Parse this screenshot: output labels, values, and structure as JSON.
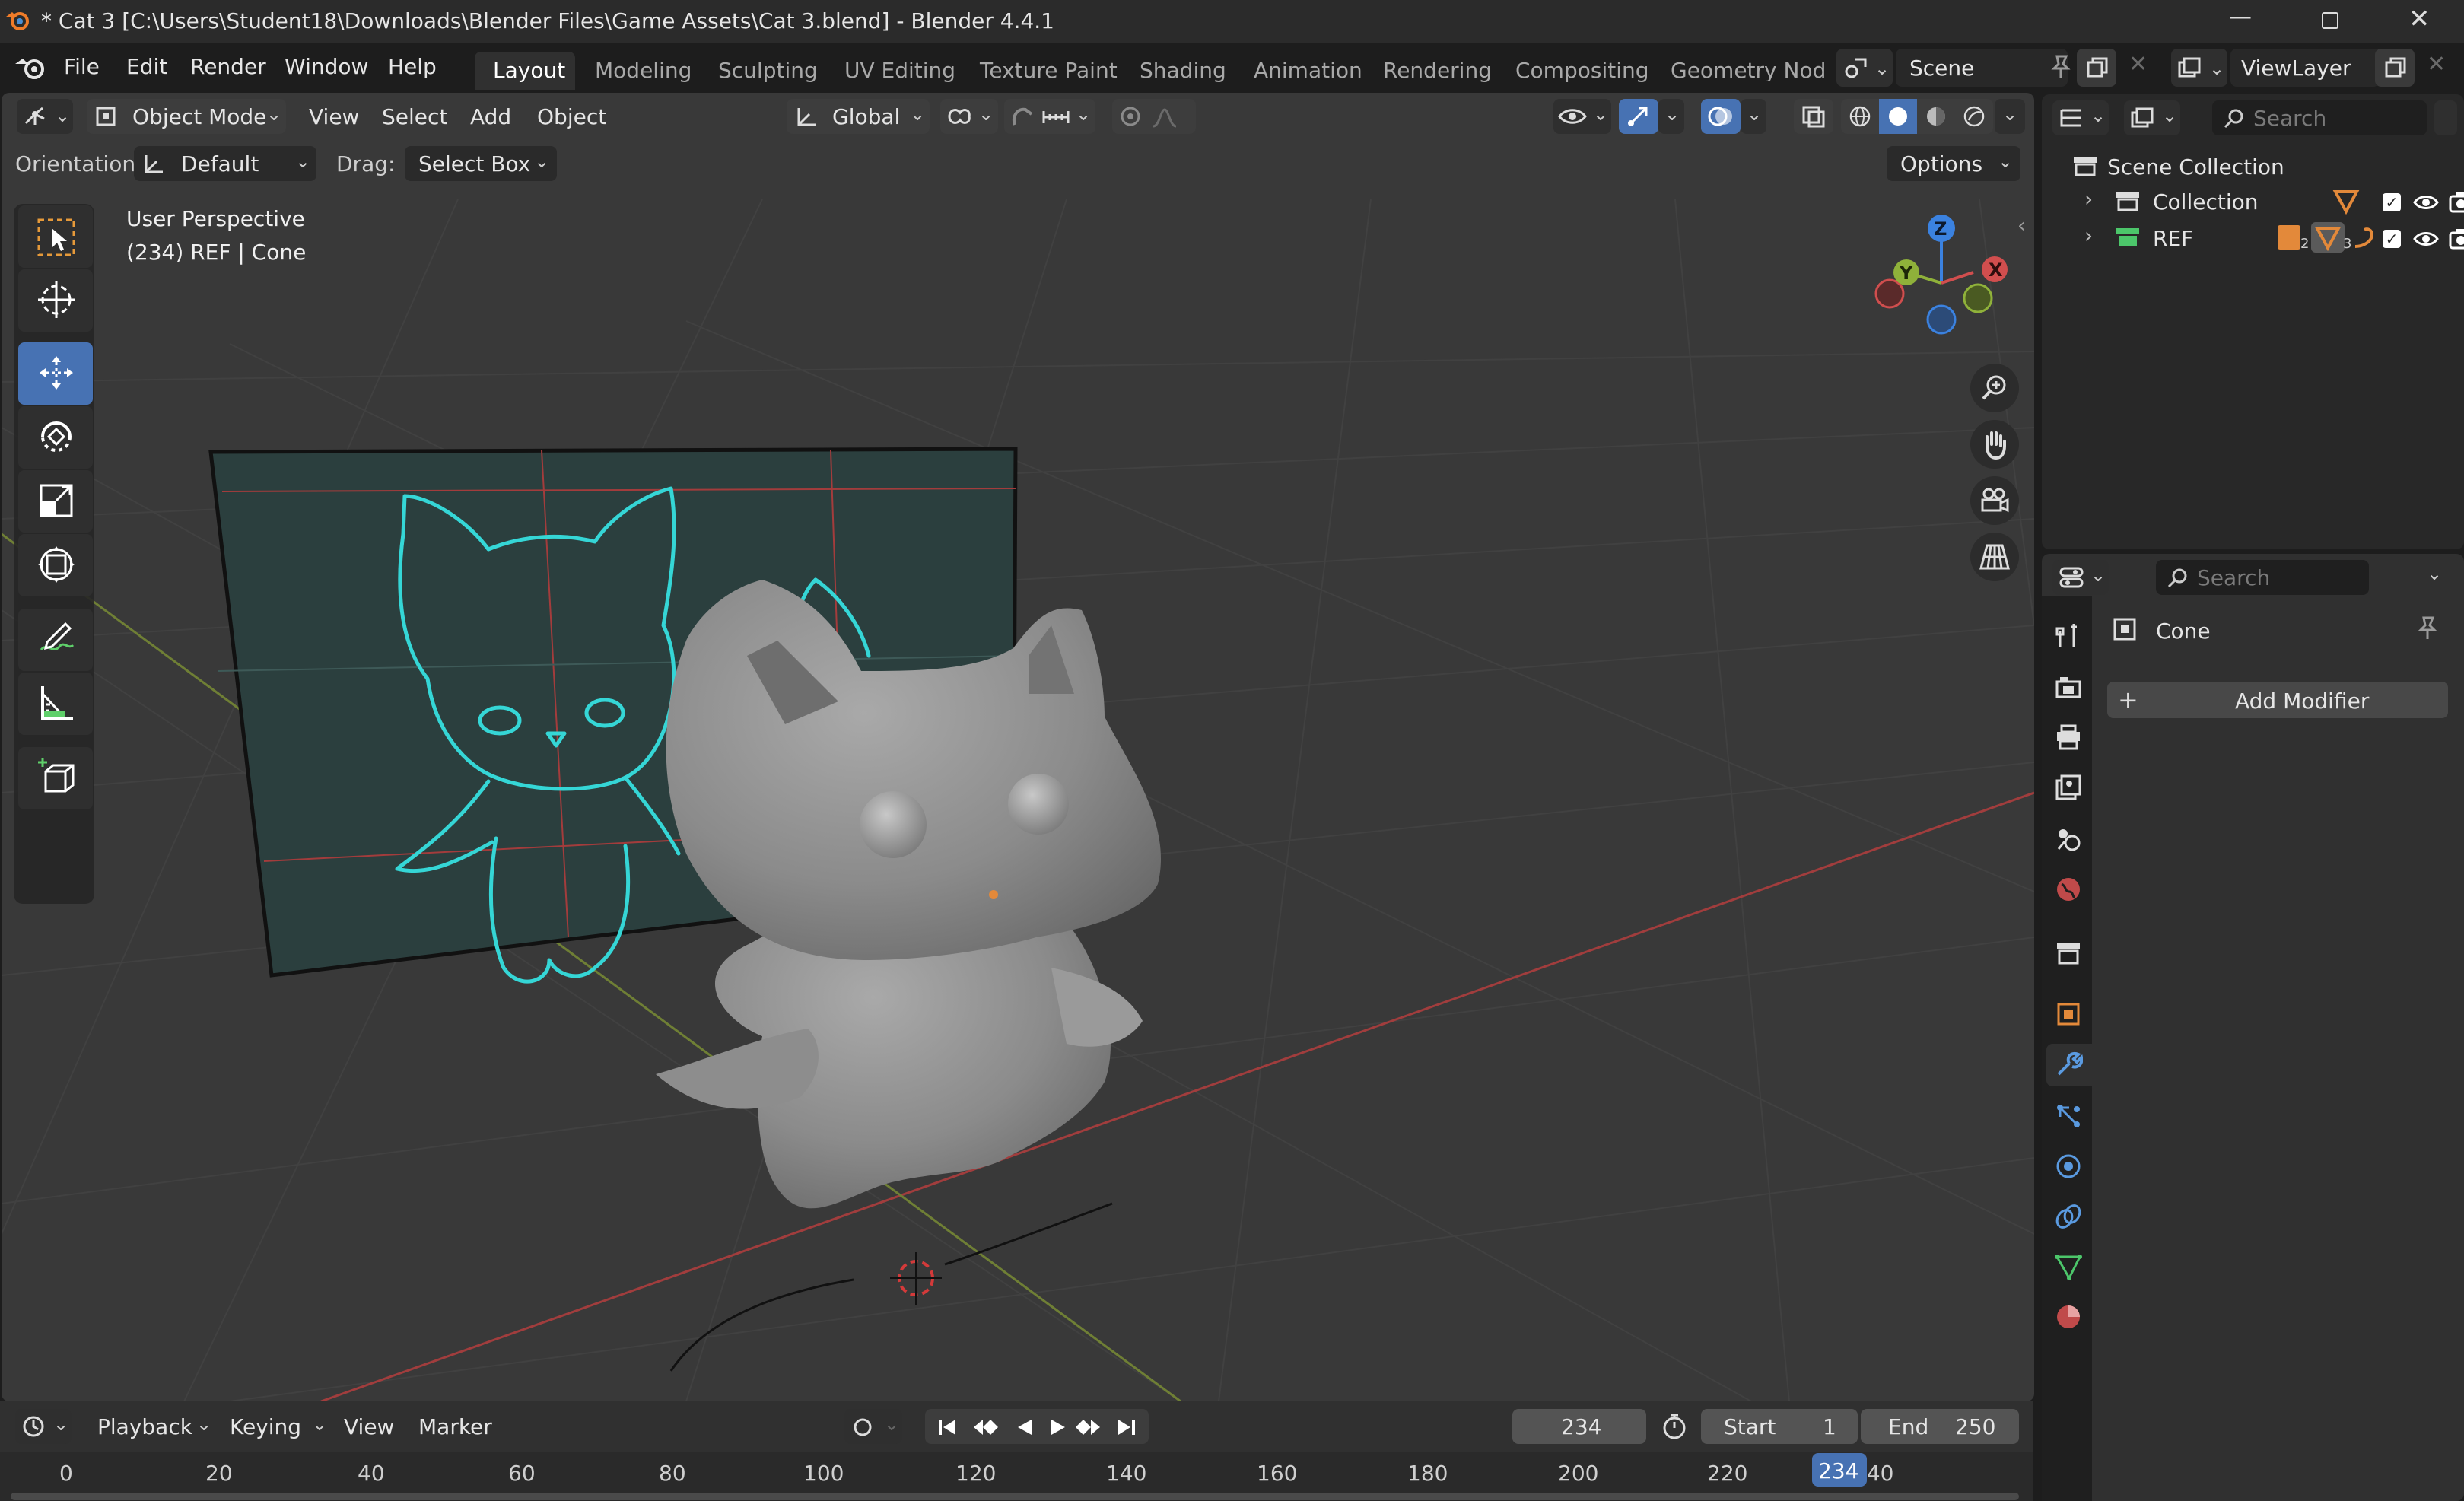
{
  "window": {
    "title": "* Cat 3 [C:\\Users\\Student18\\Downloads\\Blender Files\\Game Assets\\Cat 3.blend] - Blender 4.4.1"
  },
  "menu": {
    "items": [
      "File",
      "Edit",
      "Render",
      "Window",
      "Help"
    ]
  },
  "workspaces": {
    "tabs": [
      "Layout",
      "Modeling",
      "Sculpting",
      "UV Editing",
      "Texture Paint",
      "Shading",
      "Animation",
      "Rendering",
      "Compositing",
      "Geometry Nodes"
    ],
    "active": "Layout"
  },
  "scene": {
    "name": "Scene",
    "view_layer": "ViewLayer"
  },
  "viewport_header": {
    "mode": "Object Mode",
    "menus": [
      "View",
      "Select",
      "Add",
      "Object"
    ],
    "transform_orientation": "Global"
  },
  "tool_settings": {
    "orientation_label": "Orientation:",
    "orientation_value": "Default",
    "drag_label": "Drag:",
    "drag_value": "Select Box",
    "options": "Options"
  },
  "viewport": {
    "view_name": "User Perspective",
    "object_info": "(234) REF | Cone",
    "gizmo_axes": [
      "Z",
      "Y",
      "X"
    ]
  },
  "toolbar": {
    "tools": [
      "select-box",
      "cursor",
      "move",
      "rotate",
      "scale",
      "transform",
      "annotate",
      "measure",
      "add-cube"
    ],
    "active": "move"
  },
  "outliner": {
    "search_placeholder": "Search",
    "root": "Scene Collection",
    "items": [
      {
        "label": "Collection"
      },
      {
        "label": "REF"
      }
    ],
    "ref_counts": [
      "2",
      "3"
    ]
  },
  "properties": {
    "search_placeholder": "Search",
    "object_name": "Cone",
    "add_modifier": "Add Modifier",
    "active_tab": "modifiers"
  },
  "timeline": {
    "menus": [
      "Playback",
      "Keying",
      "View",
      "Marker"
    ],
    "current_frame": "234",
    "start_label": "Start",
    "start_value": "1",
    "end_label": "End",
    "end_value": "250",
    "ticks": [
      "0",
      "20",
      "40",
      "60",
      "80",
      "100",
      "120",
      "140",
      "160",
      "180",
      "200",
      "220",
      "240"
    ],
    "playhead": "234"
  },
  "colors": {
    "accent": "#4772b3",
    "outline_cyan": "#35d6d6",
    "axis_x": "#d14e4e",
    "axis_y": "#8fb13a",
    "axis_z": "#3b82e0",
    "object_orange": "#e3893a"
  }
}
